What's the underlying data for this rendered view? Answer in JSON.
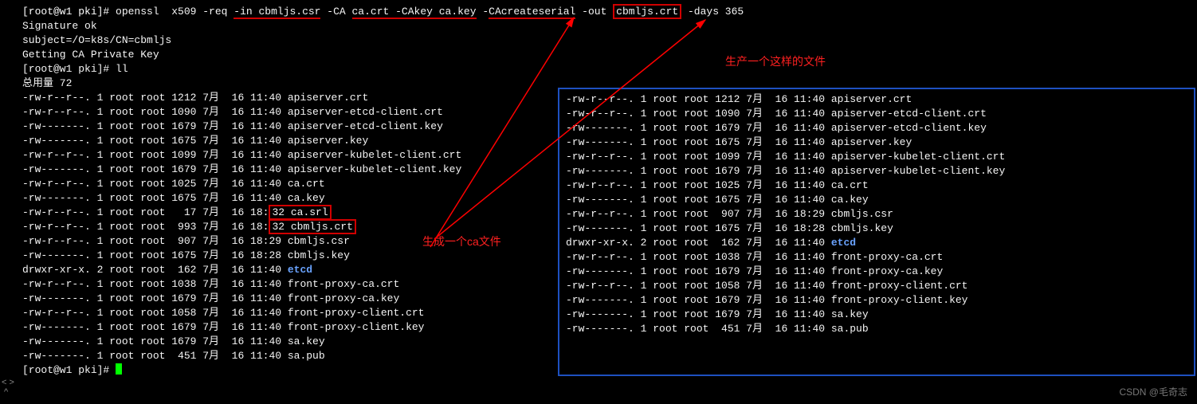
{
  "prompt1_user": "[root@w1 pki]# ",
  "cmd_prefix": "openssl  x509 -req ",
  "cmd_in": "-in cbmljs.csr",
  "cmd_mid1": " -CA ",
  "cmd_ca": "ca.crt -CAkey ca.key",
  "cmd_mid2": " -",
  "cmd_serial": "CAcreateserial",
  "cmd_mid3": " -out ",
  "cmd_out": "cbmljs.crt",
  "cmd_tail": " -days 365",
  "sig_ok": "Signature ok",
  "subject": "subject=/O=k8s/CN=cbmljs",
  "getting": "Getting CA Private Key",
  "prompt2": "[root@w1 pki]# ll",
  "total": "总用量 72",
  "left_rows": [
    "-rw-r--r--. 1 root root 1212 7月  16 11:40 apiserver.crt",
    "-rw-r--r--. 1 root root 1090 7月  16 11:40 apiserver-etcd-client.crt",
    "-rw-------. 1 root root 1679 7月  16 11:40 apiserver-etcd-client.key",
    "-rw-------. 1 root root 1675 7月  16 11:40 apiserver.key",
    "-rw-r--r--. 1 root root 1099 7月  16 11:40 apiserver-kubelet-client.crt",
    "-rw-------. 1 root root 1679 7月  16 11:40 apiserver-kubelet-client.key",
    "-rw-r--r--. 1 root root 1025 7月  16 11:40 ca.crt",
    "-rw-------. 1 root root 1675 7月  16 11:40 ca.key"
  ],
  "left_srl_pre": "-rw-r--r--. 1 root root   17 7月  16 18:",
  "left_srl_box": "32 ca.srl",
  "left_crt_pre": "-rw-r--r--. 1 root root  993 7月  16 18:",
  "left_crt_box": "32 cbmljs.crt",
  "left_rows2": [
    "-rw-r--r--. 1 root root  907 7月  16 18:29 cbmljs.csr",
    "-rw-------. 1 root root 1675 7月  16 18:28 cbmljs.key"
  ],
  "left_etcd_pre": "drwxr-xr-x. 2 root root  162 7月  16 11:40 ",
  "left_etcd": "etcd",
  "left_rows3": [
    "-rw-r--r--. 1 root root 1038 7月  16 11:40 front-proxy-ca.crt",
    "-rw-------. 1 root root 1679 7月  16 11:40 front-proxy-ca.key",
    "-rw-r--r--. 1 root root 1058 7月  16 11:40 front-proxy-client.crt",
    "-rw-------. 1 root root 1679 7月  16 11:40 front-proxy-client.key",
    "-rw-------. 1 root root 1679 7月  16 11:40 sa.key",
    "-rw-------. 1 root root  451 7月  16 11:40 sa.pub"
  ],
  "prompt3": "[root@w1 pki]# ",
  "panel_rows": [
    "-rw-r--r--. 1 root root 1212 7月  16 11:40 apiserver.crt",
    "-rw-r--r--. 1 root root 1090 7月  16 11:40 apiserver-etcd-client.crt",
    "-rw-------. 1 root root 1679 7月  16 11:40 apiserver-etcd-client.key",
    "-rw-------. 1 root root 1675 7月  16 11:40 apiserver.key",
    "-rw-r--r--. 1 root root 1099 7月  16 11:40 apiserver-kubelet-client.crt",
    "-rw-------. 1 root root 1679 7月  16 11:40 apiserver-kubelet-client.key",
    "-rw-r--r--. 1 root root 1025 7月  16 11:40 ca.crt",
    "-rw-------. 1 root root 1675 7月  16 11:40 ca.key",
    "-rw-r--r--. 1 root root  907 7月  16 18:29 cbmljs.csr",
    "-rw-------. 1 root root 1675 7月  16 18:28 cbmljs.key"
  ],
  "panel_etcd_pre": "drwxr-xr-x. 2 root root  162 7月  16 11:40 ",
  "panel_etcd": "etcd",
  "panel_rows2": [
    "-rw-r--r--. 1 root root 1038 7月  16 11:40 front-proxy-ca.crt",
    "-rw-------. 1 root root 1679 7月  16 11:40 front-proxy-ca.key",
    "-rw-r--r--. 1 root root 1058 7月  16 11:40 front-proxy-client.crt",
    "-rw-------. 1 root root 1679 7月  16 11:40 front-proxy-client.key",
    "-rw-------. 1 root root 1679 7月  16 11:40 sa.key",
    "-rw-------. 1 root root  451 7月  16 11:40 sa.pub"
  ],
  "annot_ca": "生成一个ca文件",
  "annot_file": "生产一个这样的文件",
  "watermark": "CSDN @毛奇志"
}
